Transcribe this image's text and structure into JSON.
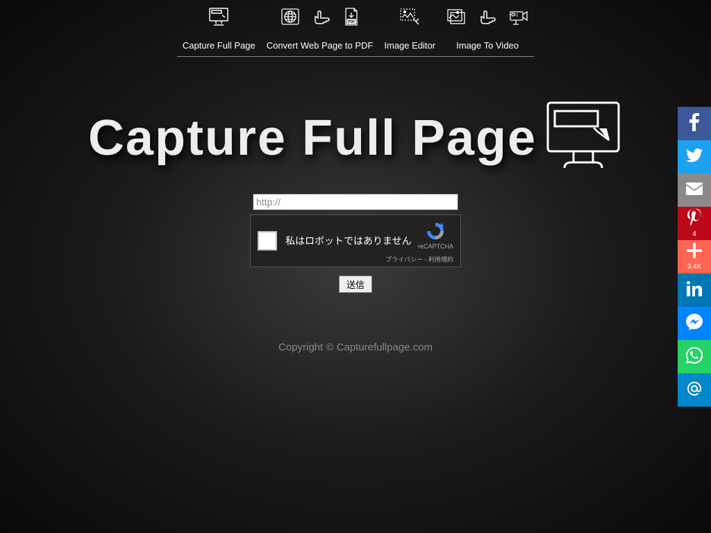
{
  "nav": [
    {
      "label": "Capture Full Page"
    },
    {
      "label": "Convert Web Page to PDF"
    },
    {
      "label": "Image Editor"
    },
    {
      "label": "Image To Video"
    }
  ],
  "hero": {
    "title": "Capture Full Page"
  },
  "form": {
    "url_value": "http://",
    "recaptcha_text": "私はロボットではありません",
    "recaptcha_brand": "reCAPTCHA",
    "recaptcha_links": "プライバシー - 利用規約",
    "submit_label": "送信"
  },
  "footer": {
    "copyright": "Copyright © Capturefullpage.com"
  },
  "social": {
    "pinterest_count": "4",
    "plus_count": "3.4K"
  }
}
